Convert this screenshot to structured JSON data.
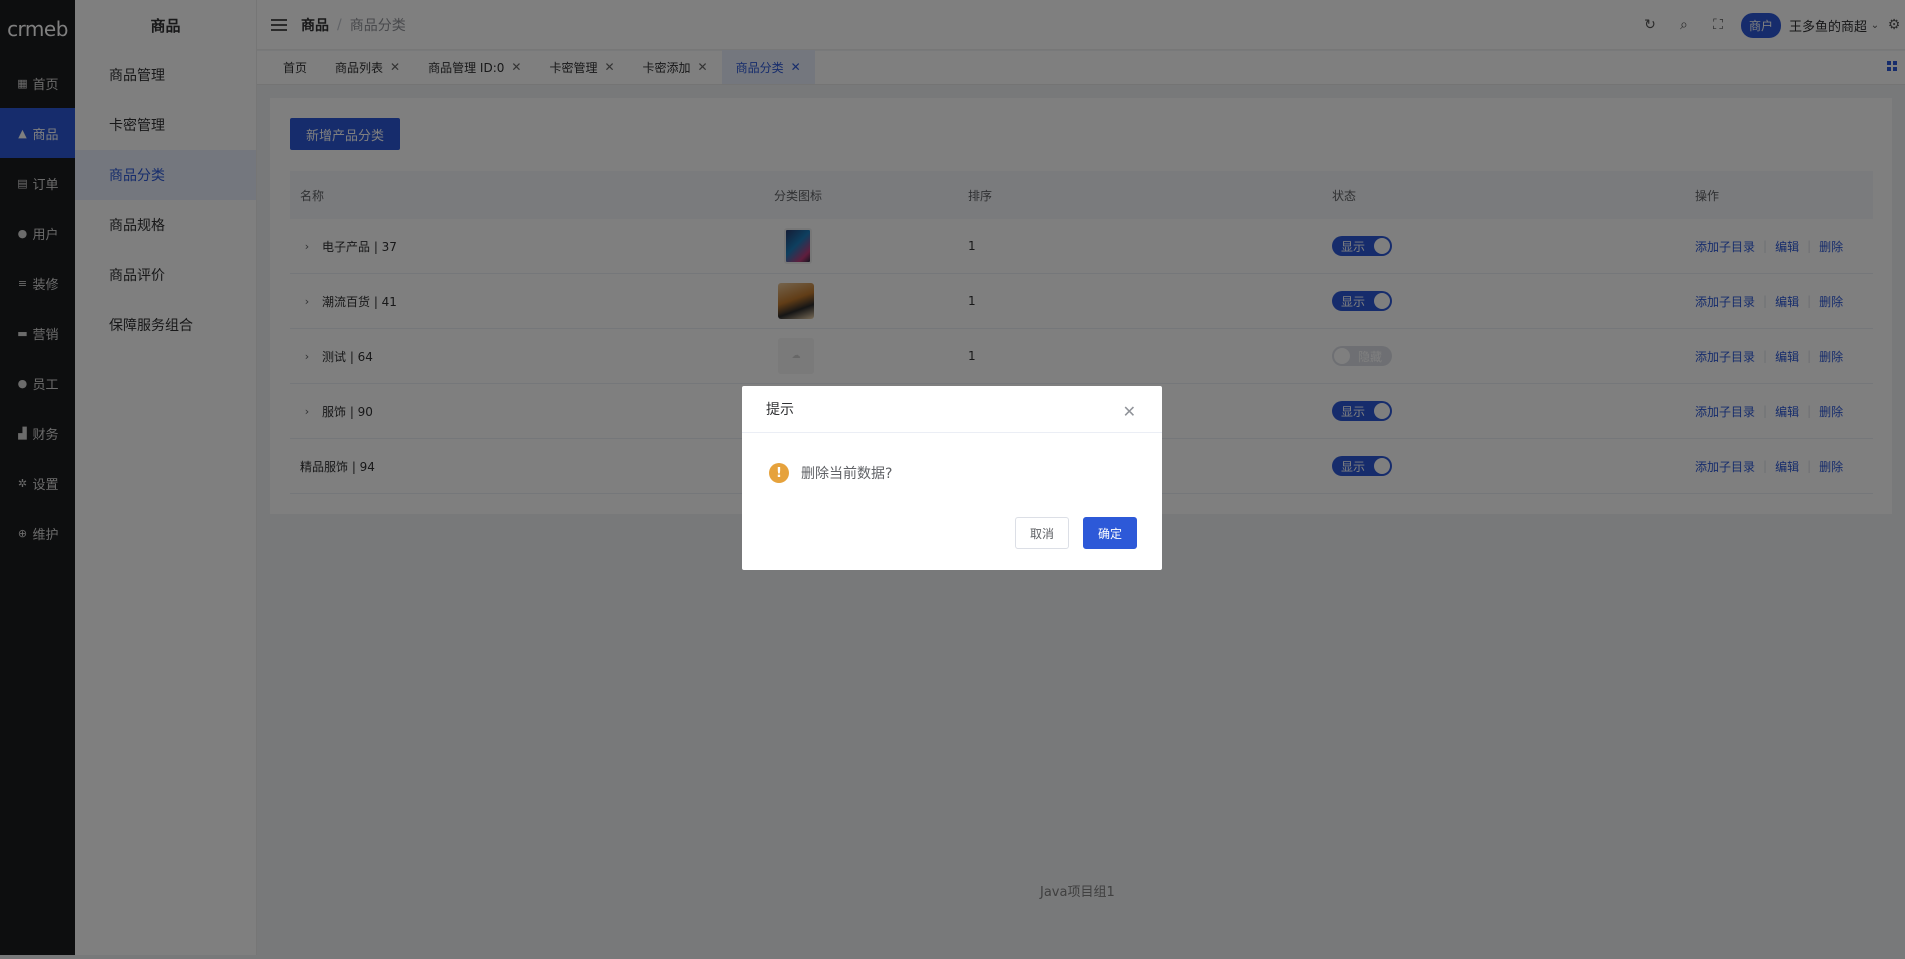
{
  "logo": "crmeb",
  "nav": [
    {
      "icon": "grid-icon",
      "glyph": "▦",
      "label": "首页"
    },
    {
      "icon": "bag-icon",
      "glyph": "▲",
      "label": "商品",
      "active": true
    },
    {
      "icon": "clipboard-icon",
      "glyph": "▤",
      "label": "订单"
    },
    {
      "icon": "user-icon",
      "glyph": "●",
      "label": "用户"
    },
    {
      "icon": "sliders-icon",
      "glyph": "≡",
      "label": "装修"
    },
    {
      "icon": "megaphone-icon",
      "glyph": "▬",
      "label": "营销"
    },
    {
      "icon": "staff-icon",
      "glyph": "●",
      "label": "员工"
    },
    {
      "icon": "chart-icon",
      "glyph": "▟",
      "label": "财务"
    },
    {
      "icon": "gear-icon",
      "glyph": "✲",
      "label": "设置"
    },
    {
      "icon": "plus-circle-icon",
      "glyph": "⊕",
      "label": "维护"
    }
  ],
  "submenu": {
    "title": "商品",
    "items": [
      {
        "label": "商品管理"
      },
      {
        "label": "卡密管理"
      },
      {
        "label": "商品分类",
        "active": true
      },
      {
        "label": "商品规格"
      },
      {
        "label": "商品评价"
      },
      {
        "label": "保障服务组合"
      }
    ]
  },
  "header": {
    "breadcrumb_root": "商品",
    "breadcrumb_sep": "/",
    "breadcrumb_current": "商品分类",
    "merchant_badge": "商户",
    "username": "王多鱼的商超"
  },
  "tabs": [
    {
      "label": "首页",
      "closable": false
    },
    {
      "label": "商品列表",
      "closable": true
    },
    {
      "label": "商品管理 ID:0",
      "closable": true
    },
    {
      "label": "卡密管理",
      "closable": true
    },
    {
      "label": "卡密添加",
      "closable": true
    },
    {
      "label": "商品分类",
      "closable": true,
      "active": true
    }
  ],
  "content": {
    "add_button": "新增产品分类",
    "columns": {
      "name": "名称",
      "icon": "分类图标",
      "sort": "排序",
      "status": "状态",
      "ops": "操作"
    },
    "rows": [
      {
        "name": "电子产品 | 37",
        "expandable": true,
        "icon": "phone",
        "sort": "1",
        "status_on": true,
        "status_label": "显示"
      },
      {
        "name": "潮流百货 | 41",
        "expandable": true,
        "icon": "fashion",
        "sort": "1",
        "status_on": true,
        "status_label": "显示"
      },
      {
        "name": "测试 | 64",
        "expandable": true,
        "icon": "empty",
        "sort": "1",
        "status_on": false,
        "status_label": "隐藏"
      },
      {
        "name": "服饰 | 90",
        "expandable": true,
        "icon": "",
        "sort": "",
        "status_on": true,
        "status_label": "显示"
      },
      {
        "name": "精品服饰 | 94",
        "expandable": false,
        "icon": "",
        "sort": "",
        "status_on": true,
        "status_label": "显示"
      }
    ],
    "ops": {
      "add_child": "添加子目录",
      "edit": "编辑",
      "delete": "删除"
    }
  },
  "footer": "Java项目组1",
  "dialog": {
    "title": "提示",
    "message": "删除当前数据?",
    "cancel": "取消",
    "confirm": "确定"
  },
  "colors": {
    "accent": "#2d59d8",
    "nav_bg": "#1b1c1f",
    "warning": "#e6a23c"
  }
}
